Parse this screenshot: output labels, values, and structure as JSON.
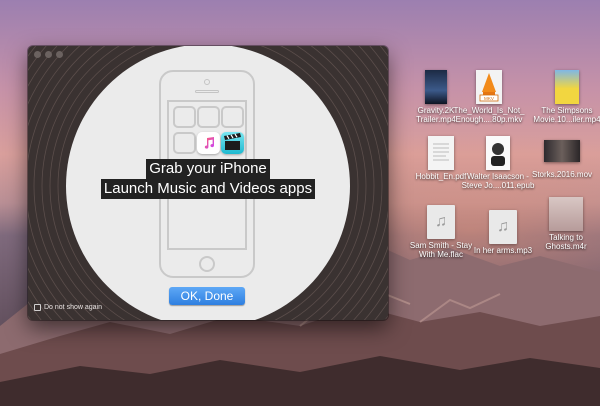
{
  "dialog": {
    "caption_line1": "Grab your iPhone",
    "caption_line2": "Launch Music and Videos apps",
    "ok_button": "OK, Done",
    "checkbox_label": "Do not show again",
    "checkbox_checked": false
  },
  "desktop": {
    "icons": [
      {
        "label": "Gravity.2K\nTrailer.mp4",
        "icon": "video-file-icon"
      },
      {
        "label": "The_World_Is_Not_\nEnough....80p.mkv",
        "icon": "vlc-mkv-file-icon"
      },
      {
        "label": "The Simpsons\nMovie.10...iler.mp4",
        "icon": "video-file-icon"
      },
      {
        "label": "Hobbit_En.pdf",
        "icon": "pdf-file-icon"
      },
      {
        "label": "Walter Isaacson -\nSteve Jo....011.epub",
        "icon": "epub-file-icon"
      },
      {
        "label": "Storks.2016.mov",
        "icon": "video-file-icon"
      },
      {
        "label": "Sam Smith - Stay\nWith Me.flac",
        "icon": "music-file-icon"
      },
      {
        "label": "In her arms.mp3",
        "icon": "music-file-icon"
      },
      {
        "label": "Talking to\nGhosts.m4r",
        "icon": "ringtone-file-icon"
      }
    ]
  },
  "colors": {
    "accent_button": "#2e7fe0",
    "dialog_bg": "#3a3231",
    "circle_bg": "#ebebeb"
  }
}
